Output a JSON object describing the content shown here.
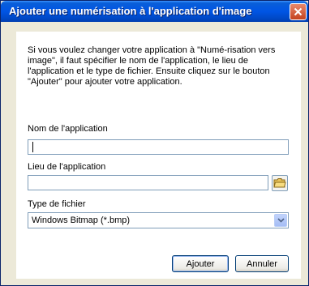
{
  "window": {
    "title": "Ajouter une numérisation à l'application d'image"
  },
  "intro": "Si vous voulez changer votre application à \"Numé-risation vers image\", il faut spécifier le nom de l'application, le lieu de l'application et le type de fichier. Ensuite cliquez sur le bouton \"Ajouter\" pour ajouter votre application.",
  "fields": {
    "app_name": {
      "label": "Nom de l'application",
      "value": ""
    },
    "app_location": {
      "label": "Lieu de l'application",
      "value": ""
    },
    "file_type": {
      "label": "Type de fichier",
      "selected": "Windows Bitmap (*.bmp)"
    }
  },
  "buttons": {
    "add": "Ajouter",
    "cancel": "Annuler"
  },
  "colors": {
    "titlebar": "#0055e5",
    "dialog_bg": "#ece9d8",
    "close_button": "#c4421e"
  }
}
